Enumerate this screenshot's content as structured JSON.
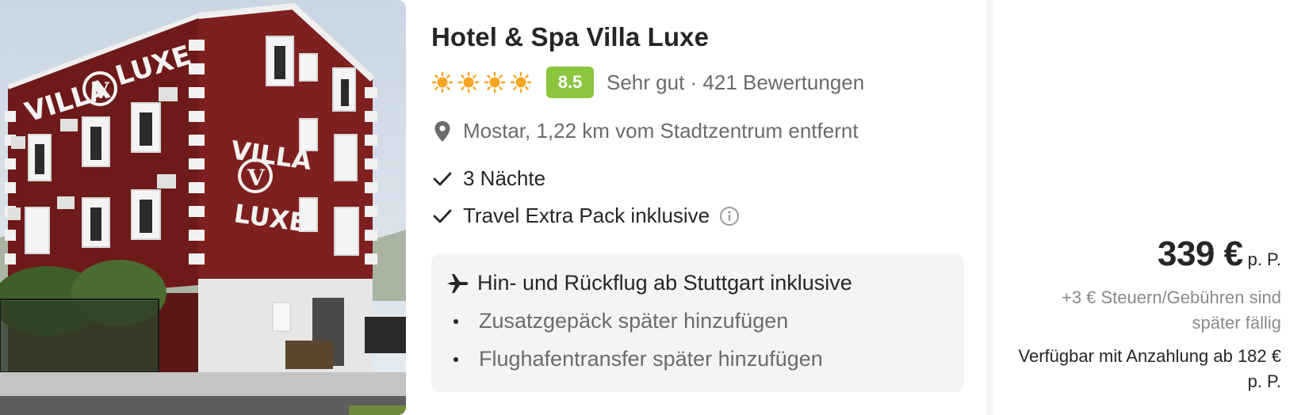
{
  "hotel": {
    "name": "Hotel & Spa Villa Luxe",
    "stars": 4,
    "score": "8.5",
    "rating_label": "Sehr gut · 421 Bewertungen",
    "location": "Mostar, 1,22 km vom Stadtzentrum entfernt",
    "photo_sign_1": "VILLA",
    "photo_sign_2": "LUXE",
    "photo_logo": "V"
  },
  "features": {
    "nights": "3 Nächte",
    "extra_pack": "Travel Extra Pack inklusive"
  },
  "flight": {
    "main": "Hin- und Rückflug ab Stuttgart inklusive",
    "options": [
      "Zusatzgepäck später hinzufügen",
      "Flughafentransfer später hinzufügen"
    ]
  },
  "price": {
    "amount": "339 €",
    "unit": "p. P.",
    "fees": "+3 € Steuern/Gebühren sind später fällig",
    "deposit": "Verfügbar mit Anzahlung ab 182 € p. P."
  },
  "colors": {
    "score_badge": "#8cc63f",
    "sun": "#f5a623",
    "building": "#7a1e1e"
  },
  "icons": {
    "star": "sun-icon",
    "location": "map-pin-icon",
    "check": "check-icon",
    "info": "info-icon",
    "flight": "airplane-icon"
  }
}
